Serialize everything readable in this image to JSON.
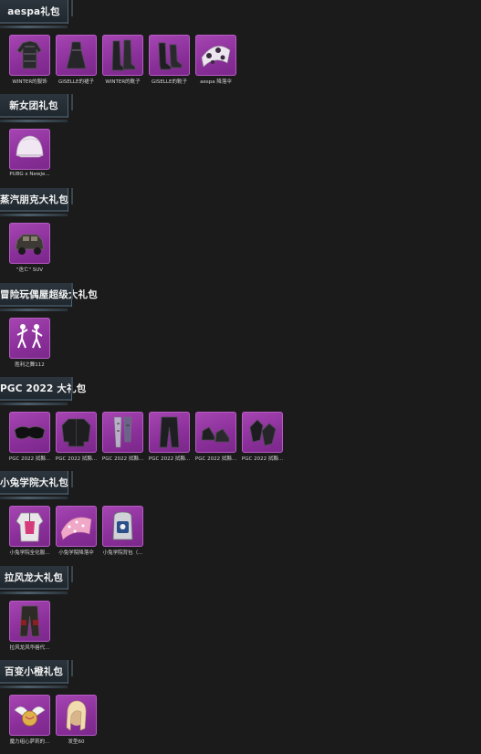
{
  "sections": [
    {
      "title": "aespa礼包",
      "items": [
        {
          "label": "WINTER的服饰",
          "icon": "outfit-dark-icon"
        },
        {
          "label": "GISELLE的裙子",
          "icon": "dress-icon"
        },
        {
          "label": "WINTER的靴子",
          "icon": "tall-boots-icon"
        },
        {
          "label": "GISELLE的靴子",
          "icon": "heel-boots-icon"
        },
        {
          "label": "aespa 降落伞",
          "icon": "parachute-floral-icon"
        }
      ]
    },
    {
      "title": "新女团礼包",
      "items": [
        {
          "label": "PUBG x NewJe...",
          "icon": "helmet-pink-icon"
        }
      ]
    },
    {
      "title": "蒸汽朋克大礼包",
      "items": [
        {
          "label": "\"迭亡\" SUV",
          "icon": "vehicle-suv-icon"
        }
      ]
    },
    {
      "title": "冒险玩偶屋超级大礼包",
      "items": [
        {
          "label": "胜利之舞112",
          "icon": "dance-emote-icon"
        }
      ]
    },
    {
      "title": "PGC 2022 大礼包",
      "items": [
        {
          "label": "PGC 2022 拭縣...",
          "icon": "goggles-icon"
        },
        {
          "label": "PGC 2022 拭縣...",
          "icon": "jacket-icon"
        },
        {
          "label": "PGC 2022 拭縣...",
          "icon": "scarf-icon"
        },
        {
          "label": "PGC 2022 拭縣...",
          "icon": "pants-icon"
        },
        {
          "label": "PGC 2022 拭縣...",
          "icon": "shoes-icon"
        },
        {
          "label": "PGC 2022 拭縣...",
          "icon": "gloves-icon"
        }
      ]
    },
    {
      "title": "小兔学院大礼包",
      "items": [
        {
          "label": "小兔学院全化服...",
          "icon": "uniform-icon"
        },
        {
          "label": "小兔学院降落伞",
          "icon": "parachute-pink-icon"
        },
        {
          "label": "小兔学院背包（...",
          "icon": "backpack-icon"
        }
      ]
    },
    {
      "title": "拉风龙大礼包",
      "items": [
        {
          "label": "拉风龙风华格代...",
          "icon": "cargo-pants-icon"
        }
      ]
    },
    {
      "title": "百变小橙礼包",
      "items": [
        {
          "label": "魔力组心萨莉的...",
          "icon": "winged-charm-icon"
        },
        {
          "label": "发型60",
          "icon": "hairstyle-icon"
        }
      ]
    }
  ]
}
